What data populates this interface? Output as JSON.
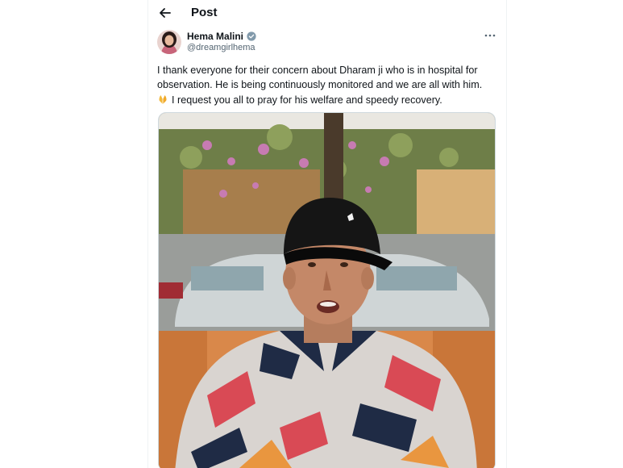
{
  "header": {
    "title": "Post"
  },
  "tweet": {
    "author_name": "Hema Malini",
    "handle": "@dreamgirlhema",
    "text_line1": "I thank everyone for their concern about Dharam ji who is in hospital for",
    "text_line2": "observation. He is being continuously monitored and we are all with him.",
    "text_line3": "I request you all to pray for his welfare and speedy recovery."
  },
  "icons": {
    "back": "arrow-left-icon",
    "verified": "verified-badge-icon",
    "more": "more-options-icon",
    "pray": "folded-hands-emoji"
  },
  "colors": {
    "verified": "#829aab",
    "text": "#0f1419",
    "secondary": "#536471",
    "border": "#eff3f4"
  }
}
